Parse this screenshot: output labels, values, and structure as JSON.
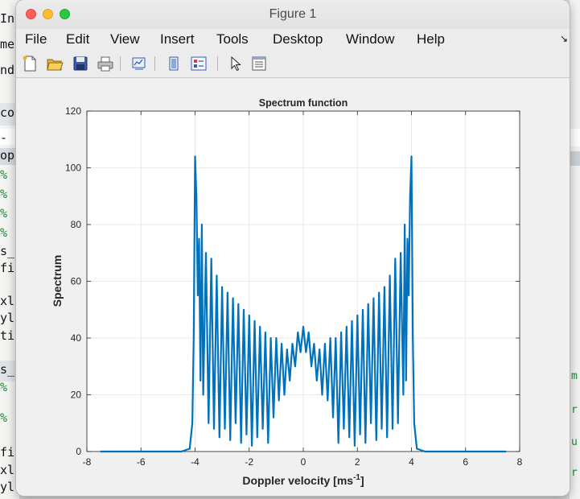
{
  "window": {
    "title": "Figure 1"
  },
  "menu": [
    "File",
    "Edit",
    "View",
    "Insert",
    "Tools",
    "Desktop",
    "Window",
    "Help"
  ],
  "toolbar": [
    {
      "icon": "new-figure-icon"
    },
    {
      "icon": "open-file-icon"
    },
    {
      "icon": "save-icon"
    },
    {
      "icon": "print-icon"
    },
    {
      "icon": "link-plot-icon"
    },
    {
      "icon": "hide-plot-tools-icon"
    },
    {
      "icon": "show-plot-tools-icon"
    },
    {
      "icon": "pointer-icon"
    },
    {
      "icon": "property-inspector-icon"
    }
  ],
  "background_editor": {
    "left_fragments": [
      "Ins",
      "me",
      "nde",
      "co",
      "-",
      "op",
      "%",
      "%",
      "%",
      "%",
      "s_",
      "fi",
      "xl",
      "yl",
      "ti",
      "s_",
      "%",
      "%",
      "fi",
      "xl",
      "yl"
    ],
    "right_fragments": [
      "m",
      "r",
      "u",
      "r"
    ]
  },
  "chart_data": {
    "type": "line",
    "title": "Spectrum function",
    "xlabel": "Doppler velocity [ms",
    "xlabel_superscript": "-1",
    "xlabel_suffix": "]",
    "ylabel": "Spectrum",
    "xlim": [
      -8,
      8
    ],
    "ylim": [
      0,
      120
    ],
    "xticks": [
      -8,
      -6,
      -4,
      -2,
      0,
      2,
      4,
      6,
      8
    ],
    "yticks": [
      0,
      20,
      40,
      60,
      80,
      100,
      120
    ],
    "grid": true,
    "line_color": "#0072BD",
    "series": [
      {
        "x": [
          -7.5,
          -5.0,
          -4.5,
          -4.2,
          -4.1,
          -4.05,
          -4.0,
          -3.95,
          -3.9,
          -3.85,
          -3.8,
          -3.75,
          -3.7,
          -3.6,
          -3.5,
          -3.4,
          -3.3,
          -3.2,
          -3.1,
          -3.0,
          -2.9,
          -2.8,
          -2.7,
          -2.6,
          -2.5,
          -2.4,
          -2.3,
          -2.2,
          -2.1,
          -2.0,
          -1.9,
          -1.8,
          -1.7,
          -1.6,
          -1.5,
          -1.4,
          -1.3,
          -1.2,
          -1.1,
          -1.0,
          -0.9,
          -0.8,
          -0.7,
          -0.6,
          -0.5,
          -0.4,
          -0.3,
          -0.2,
          -0.1,
          0.0,
          0.1,
          0.2,
          0.3,
          0.4,
          0.5,
          0.6,
          0.7,
          0.8,
          0.9,
          1.0,
          1.1,
          1.2,
          1.3,
          1.4,
          1.5,
          1.6,
          1.7,
          1.8,
          1.9,
          2.0,
          2.1,
          2.2,
          2.3,
          2.4,
          2.5,
          2.6,
          2.7,
          2.8,
          2.9,
          3.0,
          3.1,
          3.2,
          3.3,
          3.4,
          3.5,
          3.6,
          3.7,
          3.75,
          3.8,
          3.85,
          3.9,
          3.95,
          4.0,
          4.05,
          4.1,
          4.2,
          4.5,
          5.0,
          7.5
        ],
        "y": [
          0,
          0,
          0,
          1,
          10,
          40,
          104,
          90,
          55,
          75,
          25,
          80,
          20,
          70,
          10,
          68,
          8,
          62,
          5,
          58,
          8,
          56,
          4,
          54,
          10,
          52,
          3,
          50,
          6,
          48,
          2,
          46,
          5,
          44,
          8,
          42,
          3,
          40,
          12,
          40,
          18,
          38,
          20,
          36,
          25,
          38,
          30,
          42,
          35,
          44,
          35,
          42,
          30,
          38,
          25,
          36,
          20,
          38,
          18,
          40,
          12,
          40,
          3,
          42,
          8,
          44,
          5,
          46,
          2,
          48,
          6,
          50,
          3,
          52,
          10,
          54,
          4,
          56,
          8,
          58,
          5,
          62,
          8,
          68,
          10,
          70,
          20,
          80,
          25,
          75,
          55,
          90,
          104,
          40,
          10,
          1,
          0,
          0,
          0
        ]
      }
    ]
  }
}
